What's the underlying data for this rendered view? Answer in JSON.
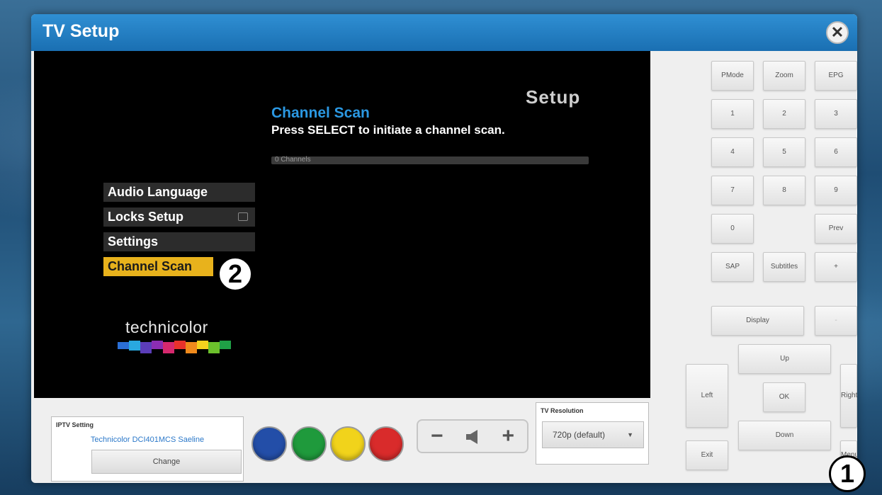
{
  "window": {
    "title": "TV Setup",
    "close_symbol": "✕"
  },
  "screen": {
    "heading": "Setup",
    "scan_title": "Channel Scan",
    "scan_desc": "Press SELECT to initiate a channel scan.",
    "progress_label": "0 Channels",
    "progress_value": 0,
    "menu": [
      "Audio Language",
      "Locks Setup",
      "Settings",
      "Channel Scan"
    ],
    "selected_menu": "Channel Scan",
    "logo_text": "technicolor"
  },
  "callouts": {
    "one": "1",
    "two": "2"
  },
  "keypad": {
    "pmode": "PMode",
    "zoom": "Zoom",
    "epg": "EPG",
    "k1": "1",
    "k2": "2",
    "k3": "3",
    "k4": "4",
    "k5": "5",
    "k6": "6",
    "k7": "7",
    "k8": "8",
    "k9": "9",
    "k0": "0",
    "prev": "Prev",
    "sap": "SAP",
    "subtitles": "Subtitles",
    "plus": "+",
    "display": "Display",
    "minus": "-",
    "up": "Up",
    "left": "Left",
    "ok": "OK",
    "right": "Right",
    "down": "Down",
    "exit": "Exit",
    "menu": "Menu"
  },
  "bottom": {
    "iptv_label": "IPTV Setting",
    "iptv_value": "Technicolor DCI401MCS Saeline",
    "change_label": "Change",
    "res_label": "TV Resolution",
    "res_value": "720p (default)",
    "vol_minus": "−",
    "vol_plus": "+"
  },
  "colors": {
    "accent": "#2b98e2",
    "menu_highlight": "#e8b21c",
    "remote_buttons": [
      "#234ea8",
      "#1f9a3c",
      "#f1d31b",
      "#d92b2b"
    ]
  }
}
